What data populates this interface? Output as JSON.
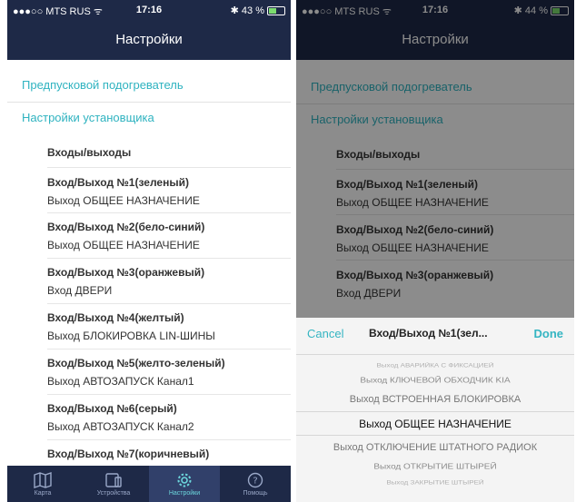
{
  "colors": {
    "nav": "#1e2947",
    "accent": "#2fb3c0",
    "tab_active": "#31406a"
  },
  "left": {
    "status": {
      "carrier": "●●●○○ MTS RUS ᯤ",
      "time": "17:16",
      "battery": "✱ 43 %"
    },
    "title": "Настройки",
    "links": [
      "Предпусковой подогреватель",
      "Настройки установщика"
    ],
    "subheader": "Входы/выходы",
    "rows": [
      {
        "l1": "Вход/Выход №1(зеленый)",
        "l2": "Выход ОБЩЕЕ НАЗНАЧЕНИЕ"
      },
      {
        "l1": "Вход/Выход №2(бело-синий)",
        "l2": "Выход ОБЩЕЕ НАЗНАЧЕНИЕ"
      },
      {
        "l1": "Вход/Выход №3(оранжевый)",
        "l2": "Вход ДВЕРИ"
      },
      {
        "l1": "Вход/Выход №4(желтый)",
        "l2": "Выход БЛОКИРОВКА LIN-ШИНЫ"
      },
      {
        "l1": "Вход/Выход №5(желто-зеленый)",
        "l2": "Выход АВТОЗАПУСК Канал1"
      },
      {
        "l1": "Вход/Выход №6(серый)",
        "l2": "Выход АВТОЗАПУСК Канал2"
      },
      {
        "l1": "Вход/Выход №7(коричневый)",
        "l2": ""
      }
    ],
    "tabs": [
      {
        "label": "Карта",
        "icon": "map-icon"
      },
      {
        "label": "Устройства",
        "icon": "devices-icon"
      },
      {
        "label": "Настройки",
        "icon": "gear-icon"
      },
      {
        "label": "Помощь",
        "icon": "help-icon"
      }
    ]
  },
  "right": {
    "status": {
      "carrier": "●●●○○ MTS RUS ᯤ",
      "time": "17:16",
      "battery": "✱ 44 %"
    },
    "title": "Настройки",
    "links": [
      "Предпусковой подогреватель",
      "Настройки установщика"
    ],
    "subheader": "Входы/выходы",
    "rows": [
      {
        "l1": "Вход/Выход №1(зеленый)",
        "l2": "Выход ОБЩЕЕ НАЗНАЧЕНИЕ"
      },
      {
        "l1": "Вход/Выход №2(бело-синий)",
        "l2": "Выход ОБЩЕЕ НАЗНАЧЕНИЕ"
      },
      {
        "l1": "Вход/Выход №3(оранжевый)",
        "l2": "Вход ДВЕРИ"
      }
    ],
    "picker": {
      "cancel": "Cancel",
      "title": "Вход/Выход №1(зел...",
      "done": "Done",
      "options": [
        "Выход АВАРИЙКА С ФИКСАЦИЕЙ",
        "Выход КЛЮЧЕВОЙ ОБХОДЧИК KIA",
        "Выход ВСТРОЕННАЯ БЛОКИРОВКА",
        "Выход ОБЩЕЕ НАЗНАЧЕНИЕ",
        "Выход ОТКЛЮЧЕНИЕ ШТАТНОГО РАДИОК",
        "Выход ОТКРЫТИЕ ШТЫРЕЙ",
        "Выход ЗАКРЫТИЕ ШТЫРЕЙ"
      ],
      "selected": "Выход ОБЩЕЕ НАЗНАЧЕНИЕ"
    }
  }
}
